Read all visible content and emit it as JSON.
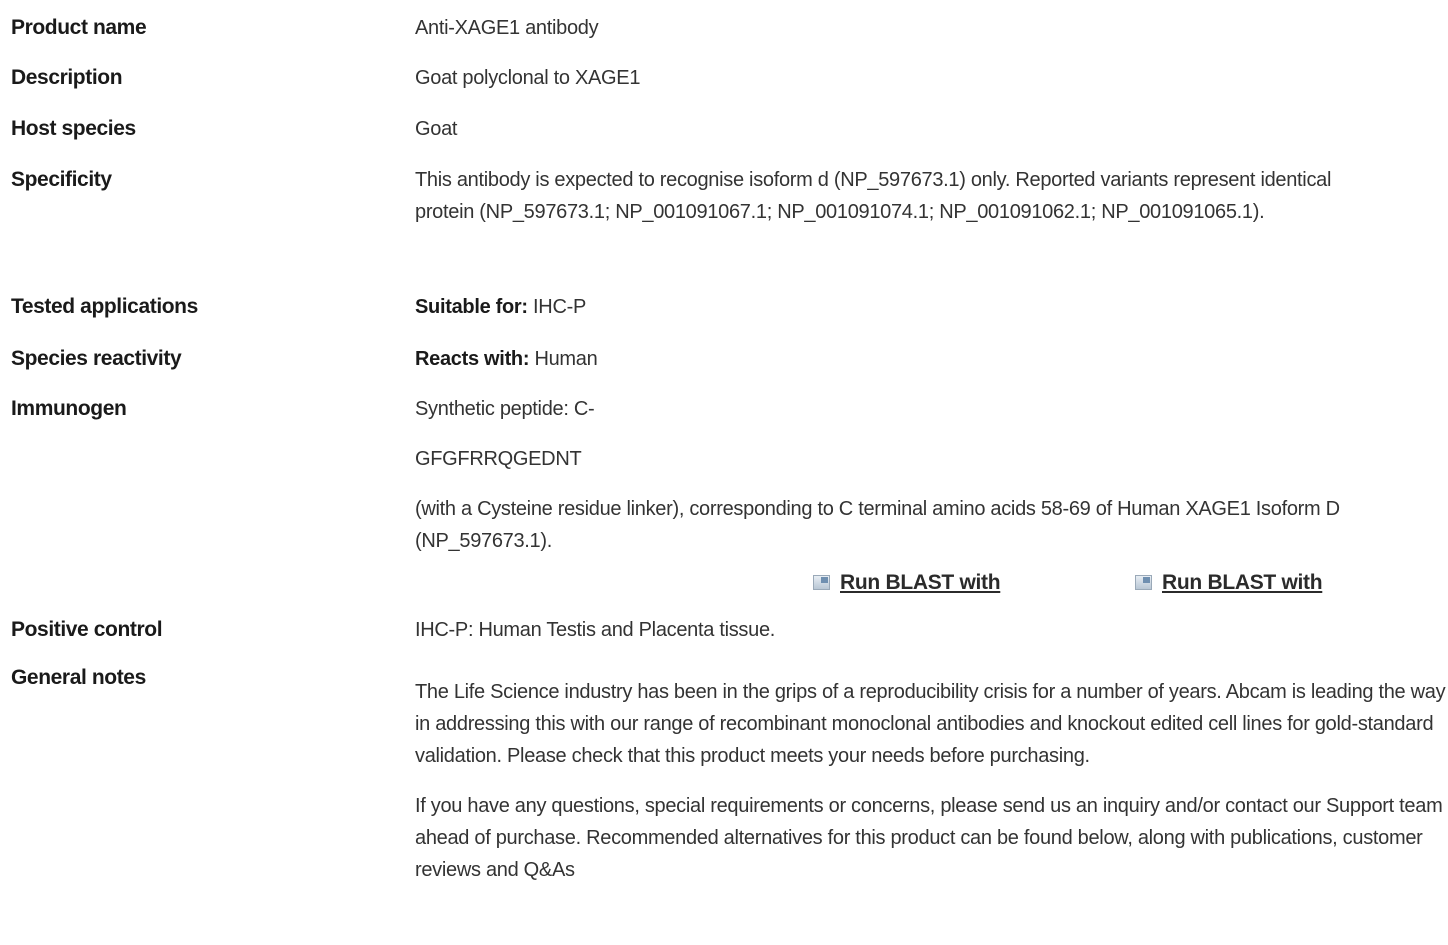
{
  "rows": {
    "product_name": {
      "label": "Product name",
      "value": "Anti-XAGE1 antibody"
    },
    "description": {
      "label": "Description",
      "value": "Goat polyclonal to XAGE1"
    },
    "host_species": {
      "label": "Host species",
      "value": "Goat"
    },
    "specificity": {
      "label": "Specificity",
      "value": "This antibody is expected to recognise isoform d (NP_597673.1) only. Reported variants represent identical protein (NP_597673.1; NP_001091067.1; NP_001091074.1; NP_001091062.1; NP_001091065.1)."
    },
    "tested_applications": {
      "label": "Tested applications",
      "prefix": "Suitable for:",
      "value": " IHC-P"
    },
    "species_reactivity": {
      "label": "Species reactivity",
      "prefix": "Reacts with:",
      "value": " Human"
    },
    "immunogen": {
      "label": "Immunogen",
      "line1": "Synthetic peptide: C-",
      "line2": "GFGFRRQGEDNT",
      "line3": "(with a Cysteine residue linker), corresponding to C terminal amino acids 58-69 of Human XAGE1 Isoform D (NP_597673.1).",
      "blast_links": [
        "Run BLAST with",
        "Run BLAST with"
      ]
    },
    "positive_control": {
      "label": "Positive control",
      "value": "IHC-P: Human Testis and Placenta tissue."
    },
    "general_notes": {
      "label": "General notes",
      "para1": "The Life Science industry has been in the grips of a reproducibility crisis for a number of years. Abcam is leading the way in addressing this with our range of recombinant monoclonal antibodies and knockout edited cell lines for gold-standard validation. Please check that this product meets your needs before purchasing.",
      "para2": "If you have any questions, special requirements or concerns, please send us an inquiry and/or contact our Support team ahead of purchase. Recommended alternatives for this product can be found below, along with publications, customer reviews and Q&As"
    }
  },
  "icons": {
    "blast_link_icon": "external-link-icon"
  }
}
